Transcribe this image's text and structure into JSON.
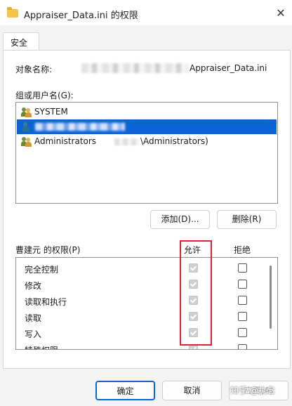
{
  "window": {
    "title": "Appraiser_Data.ini 的权限",
    "close_glyph": "✕"
  },
  "tabs": [
    {
      "label": "安全"
    }
  ],
  "object": {
    "label": "对象名称:",
    "name_suffix": "Appraiser_Data.ini"
  },
  "group": {
    "label": "组或用户名(G):",
    "users": [
      {
        "name": "SYSTEM",
        "icon": "user-group-icon"
      },
      {
        "name": "",
        "icon": "user-icon",
        "selected": true
      },
      {
        "name": "Administrators",
        "suffix": "\\Administrators)",
        "icon": "user-group-icon"
      }
    ]
  },
  "buttons": {
    "add": "添加(D)...",
    "remove": "删除(R)",
    "ok": "确定",
    "cancel": "取消",
    "apply": "应用(A)"
  },
  "permissions": {
    "label": "曹建元 的权限(P)",
    "allow_header": "允许",
    "deny_header": "拒绝",
    "rows": [
      {
        "name": "完全控制",
        "allow": true,
        "deny": false
      },
      {
        "name": "修改",
        "allow": true,
        "deny": false
      },
      {
        "name": "读取和执行",
        "allow": true,
        "deny": false
      },
      {
        "name": "读取",
        "allow": true,
        "deny": false
      },
      {
        "name": "写入",
        "allow": true,
        "deny": false
      },
      {
        "name": "特殊权限",
        "allow": false,
        "deny": false
      }
    ]
  },
  "watermark": "知乎 @执念",
  "colors": {
    "selection": "#0a64d6",
    "highlight_box": "#d9252f"
  }
}
